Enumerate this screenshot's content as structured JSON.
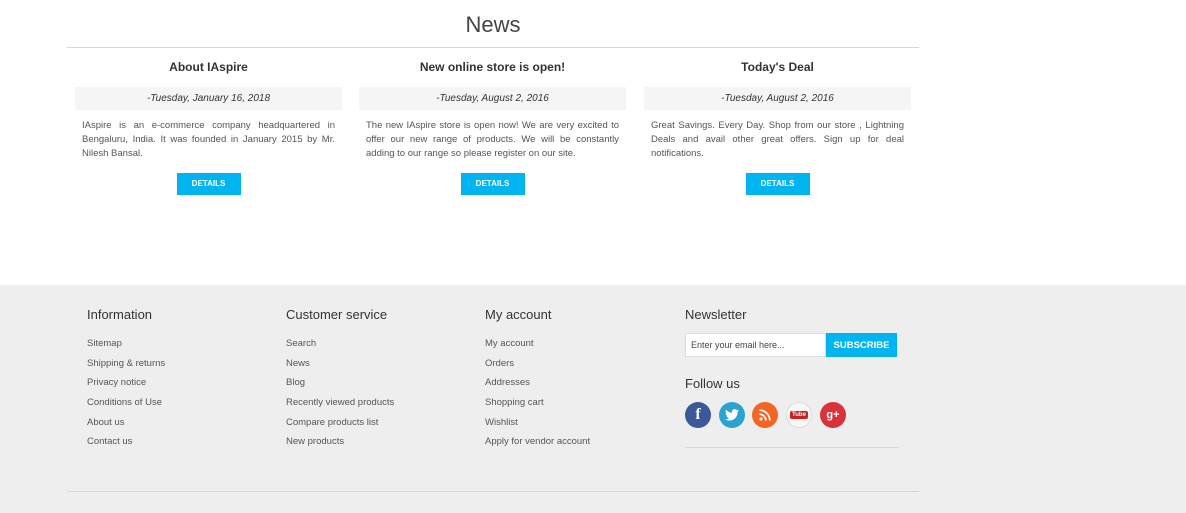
{
  "news": {
    "title": "News",
    "items": [
      {
        "heading": "About IAspire",
        "date": "-Tuesday, January 16, 2018",
        "text": "IAspire is an e-commerce company headquartered in Bengaluru, India. It was founded in January 2015 by Mr. Nilesh Bansal.",
        "button": "DETAILS"
      },
      {
        "heading": "New online store is open!",
        "date": "-Tuesday, August 2, 2016",
        "text": "The new IAspire store is open now! We are very excited to offer our new range of products. We will be constantly adding to our range so please register on our site.",
        "button": "DETAILS"
      },
      {
        "heading": "Today's Deal",
        "date": "-Tuesday, August 2, 2016",
        "text": "Great Savings. Every Day. Shop from our store , Lightning Deals and avail other great offers. Sign up for deal notifications.",
        "button": "DETAILS"
      }
    ]
  },
  "footer": {
    "information": {
      "title": "Information",
      "links": [
        "Sitemap",
        "Shipping & returns",
        "Privacy notice",
        "Conditions of Use",
        "About us",
        "Contact us"
      ]
    },
    "customer_service": {
      "title": "Customer service",
      "links": [
        "Search",
        "News",
        "Blog",
        "Recently viewed products",
        "Compare products list",
        "New products"
      ]
    },
    "my_account": {
      "title": "My account",
      "links": [
        "My account",
        "Orders",
        "Addresses",
        "Shopping cart",
        "Wishlist",
        "Apply for vendor account"
      ]
    },
    "newsletter": {
      "title": "Newsletter",
      "placeholder": "Enter your email here...",
      "button": "SUBSCRIBE"
    },
    "follow": {
      "title": "Follow us",
      "icons": [
        "facebook-icon",
        "twitter-icon",
        "rss-icon",
        "youtube-icon",
        "google-plus-icon"
      ]
    }
  },
  "colors": {
    "accent": "#00b4f0",
    "footer_bg": "#eeeeee",
    "facebook": "#3b5998",
    "twitter": "#2aa4cf",
    "rss": "#f26522",
    "youtube": "#cc2222",
    "google_plus": "#d8333a"
  }
}
